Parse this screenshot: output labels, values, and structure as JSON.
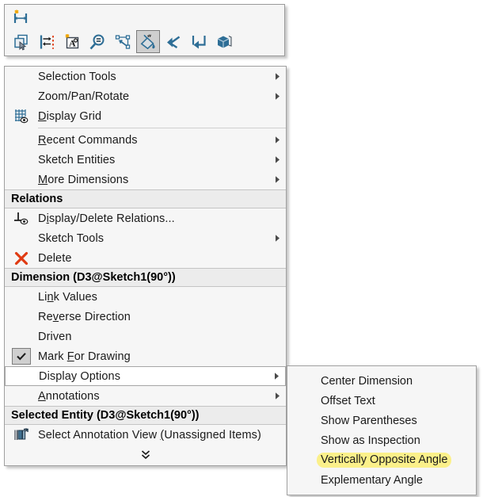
{
  "toolbar": {
    "name": "sketch-context-toolbar",
    "row1": [
      {
        "id": "smart-dimension",
        "icon": "smart-dimension-icon",
        "label": "Smart Dimension",
        "active": false
      }
    ],
    "row2": [
      {
        "id": "select-other",
        "icon": "select-other-icon",
        "label": "Select Other",
        "active": false
      },
      {
        "id": "fully-define-sketch",
        "icon": "fully-define-sketch-icon",
        "label": "Fully Define Sketch",
        "active": false
      },
      {
        "id": "note",
        "icon": "note-icon",
        "label": "Note",
        "active": false
      },
      {
        "id": "zoom-to-area",
        "icon": "zoom-to-area-icon",
        "label": "Zoom to Area",
        "active": false
      },
      {
        "id": "add-relation",
        "icon": "add-relation-icon",
        "label": "Add Relation",
        "active": false
      },
      {
        "id": "display-options",
        "icon": "dimension-paint-icon",
        "label": "Display Options",
        "active": true
      },
      {
        "id": "undo",
        "icon": "undo-arrow-icon",
        "label": "Undo",
        "active": false
      },
      {
        "id": "redo",
        "icon": "redo-arrow-icon",
        "label": "Redo",
        "active": false
      },
      {
        "id": "isometric-view",
        "icon": "isometric-view-icon",
        "label": "Isometric View",
        "active": false
      }
    ]
  },
  "menu": {
    "name": "sketch-context-menu",
    "items": [
      {
        "type": "item",
        "name": "menu-item-selection-tools",
        "icon": null,
        "acc": "",
        "pre": "Selection Tools",
        "post": "",
        "submenu": true,
        "highlight": false
      },
      {
        "type": "item",
        "name": "menu-item-zoom-pan-rotate",
        "icon": null,
        "acc": "",
        "pre": "Zoom/Pan/Rotate",
        "post": "",
        "submenu": true,
        "highlight": false
      },
      {
        "type": "item",
        "name": "menu-item-display-grid",
        "icon": "display-grid-icon",
        "acc": "D",
        "pre": "",
        "post": "isplay Grid",
        "submenu": false,
        "highlight": false
      },
      {
        "type": "separator",
        "name": "menu-separator-1"
      },
      {
        "type": "item",
        "name": "menu-item-recent-commands",
        "icon": null,
        "acc": "R",
        "pre": "",
        "post": "ecent Commands",
        "submenu": true,
        "highlight": false
      },
      {
        "type": "item",
        "name": "menu-item-sketch-entities",
        "icon": null,
        "acc": "",
        "pre": "Sketch Entities",
        "post": "",
        "submenu": true,
        "highlight": false
      },
      {
        "type": "item",
        "name": "menu-item-more-dimensions",
        "icon": null,
        "acc": "M",
        "pre": "",
        "post": "ore Dimensions",
        "submenu": true,
        "highlight": false
      },
      {
        "type": "header",
        "name": "menu-section-relations",
        "label": "Relations"
      },
      {
        "type": "item",
        "name": "menu-item-display-delete-relations",
        "icon": "display-delete-relations-icon",
        "acc": "i",
        "pre": "D",
        "post": "splay/Delete Relations...",
        "submenu": false,
        "highlight": false
      },
      {
        "type": "item",
        "name": "menu-item-sketch-tools",
        "icon": null,
        "acc": "",
        "pre": "Sketch Tools",
        "post": "",
        "submenu": true,
        "highlight": false
      },
      {
        "type": "item",
        "name": "menu-item-delete",
        "icon": "delete-x-icon",
        "acc": "",
        "pre": "Delete",
        "post": "",
        "submenu": false,
        "highlight": false
      },
      {
        "type": "header",
        "name": "menu-section-dimension",
        "label": "Dimension (D3@Sketch1(90°))"
      },
      {
        "type": "item",
        "name": "menu-item-link-values",
        "icon": null,
        "acc": "n",
        "pre": "Li",
        "post": "k Values",
        "submenu": false,
        "highlight": false
      },
      {
        "type": "item",
        "name": "menu-item-reverse-direction",
        "icon": null,
        "acc": "v",
        "pre": "Re",
        "post": "erse Direction",
        "submenu": false,
        "highlight": false
      },
      {
        "type": "item",
        "name": "menu-item-driven",
        "icon": null,
        "acc": "",
        "pre": "Driven",
        "post": "",
        "submenu": false,
        "highlight": false
      },
      {
        "type": "item",
        "name": "menu-item-mark-for-drawing",
        "icon": "checked-box-icon",
        "acc": "F",
        "pre": "Mark ",
        "post": "or Drawing",
        "submenu": false,
        "highlight": false
      },
      {
        "type": "item",
        "name": "menu-item-display-options",
        "icon": null,
        "acc": "",
        "pre": "Display Options",
        "post": "",
        "submenu": true,
        "highlight": true
      },
      {
        "type": "item",
        "name": "menu-item-annotations",
        "icon": null,
        "acc": "A",
        "pre": "",
        "post": "nnotations",
        "submenu": true,
        "highlight": false
      },
      {
        "type": "header",
        "name": "menu-section-selected-entity",
        "label": "Selected Entity (D3@Sketch1(90°))"
      },
      {
        "type": "item",
        "name": "menu-item-select-annotation-view",
        "icon": "select-annotation-view-icon",
        "acc": "(",
        "pre": "Select Annotation View ",
        "post": "Unassigned Items)",
        "submenu": false,
        "highlight": false
      },
      {
        "type": "expand",
        "name": "menu-expand-more",
        "icon": "double-chevron-down-icon"
      }
    ]
  },
  "submenu": {
    "name": "display-options-submenu",
    "items": [
      {
        "name": "submenu-item-center-dimension",
        "acc": "C",
        "pre": "",
        "post": "enter Dimension",
        "highlight": false
      },
      {
        "name": "submenu-item-offset-text",
        "acc": "O",
        "pre": "",
        "post": "ffset Text",
        "highlight": false
      },
      {
        "name": "submenu-item-show-parentheses",
        "acc": "S",
        "pre": "",
        "post": "how Parentheses",
        "highlight": false
      },
      {
        "name": "submenu-item-show-as-inspection",
        "acc": "h",
        "pre": "S",
        "post": "ow as Inspection",
        "highlight": false
      },
      {
        "name": "submenu-item-vertically-opposite-angle",
        "acc": "V",
        "pre": "",
        "post": "ertically Opposite Angle",
        "highlight": true
      },
      {
        "name": "submenu-item-explementary-angle",
        "acc": "E",
        "pre": "",
        "post": "xplementary Angle",
        "highlight": false
      }
    ]
  },
  "colors": {
    "menu_bg": "#f6f6f6",
    "section_header_bg": "#ececec",
    "highlight_yellow": "#fbf08a",
    "accent_blue": "#2e6e96",
    "delete_red": "#e03a12",
    "border": "#a0a0a0"
  }
}
